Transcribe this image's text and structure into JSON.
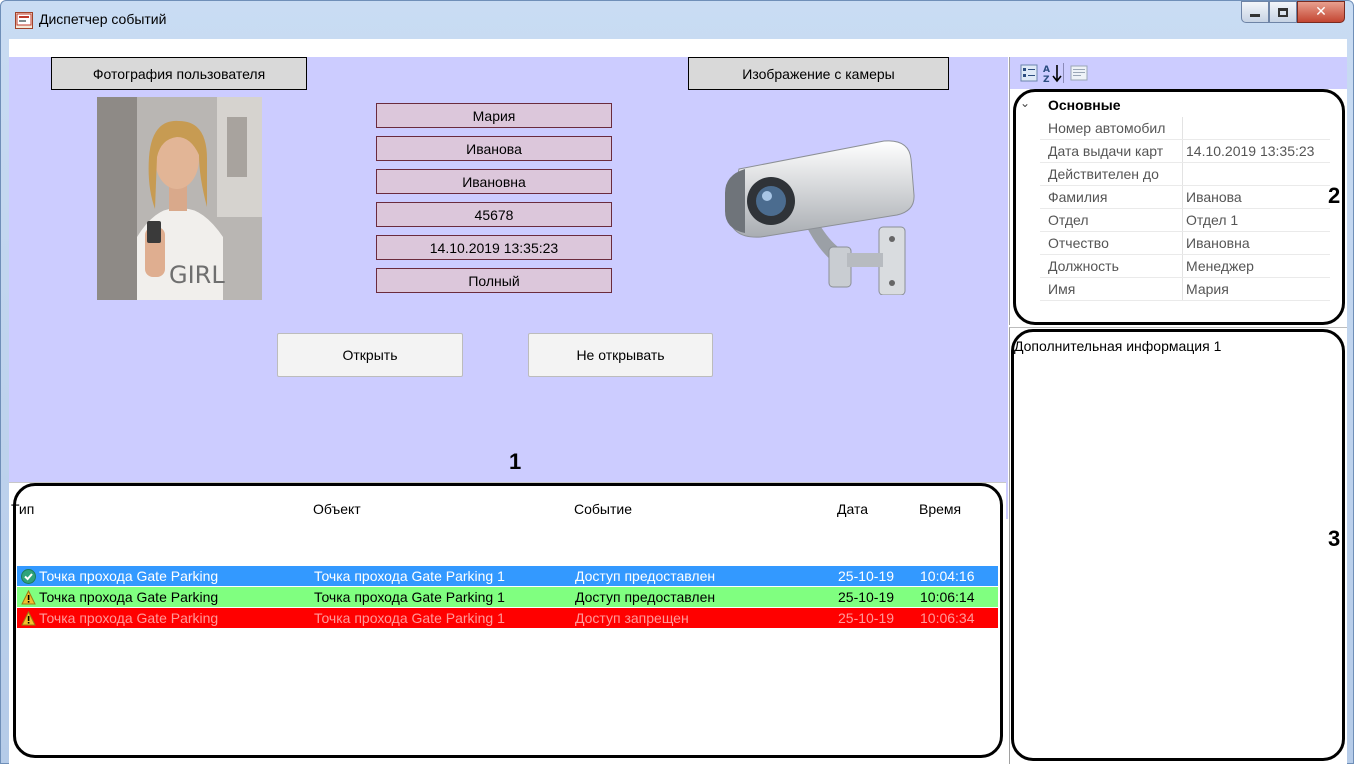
{
  "window": {
    "title": "Диспетчер событий"
  },
  "card": {
    "photo_header": "Фотография пользователя",
    "camera_header": "Изображение с камеры",
    "first_name": "Мария",
    "last_name": "Иванова",
    "patronymic": "Ивановна",
    "number": "45678",
    "datetime": "14.10.2019 13:35:23",
    "access_level": "Полный",
    "open_button": "Открыть",
    "dont_open_button": "Не открывать",
    "photo_shirt_text": "GIRL"
  },
  "labels": {
    "area1": "1",
    "area2": "2",
    "area3": "3"
  },
  "events": {
    "columns": [
      "Тип",
      "Объект",
      "Событие",
      "Дата",
      "Время"
    ],
    "rows": [
      {
        "type": "Точка прохода Gate Parking",
        "object": "Точка прохода Gate Parking 1",
        "event": "Доступ предоставлен",
        "date": "25-10-19",
        "time": "10:04:16",
        "color": "#3399ff",
        "text_color": "#ffffff",
        "icon": "check-icon"
      },
      {
        "type": "Точка прохода Gate Parking",
        "object": "Точка прохода Gate Parking 1",
        "event": "Доступ предоставлен",
        "date": "25-10-19",
        "time": "10:06:14",
        "color": "#80ff80",
        "text_color": "#000000",
        "icon": "warning-icon"
      },
      {
        "type": "Точка прохода Gate Parking",
        "object": "Точка прохода Gate Parking 1",
        "event": "Доступ запрещен",
        "date": "25-10-19",
        "time": "10:06:34",
        "color": "#ff0000",
        "text_color": "#ff9a9a",
        "icon": "warning-icon"
      }
    ]
  },
  "properties": {
    "category": "Основные",
    "rows": [
      {
        "key": "Номер автомобил",
        "value": ""
      },
      {
        "key": "Дата выдачи карт",
        "value": "14.10.2019 13:35:23"
      },
      {
        "key": "Действителен до",
        "value": ""
      },
      {
        "key": "Фамилия",
        "value": "Иванова"
      },
      {
        "key": "Отдел",
        "value": "Отдел 1"
      },
      {
        "key": "Отчество",
        "value": "Ивановна"
      },
      {
        "key": "Должность",
        "value": "Менеджер"
      },
      {
        "key": "Имя",
        "value": "Мария"
      }
    ]
  },
  "extra": {
    "text": "Дополнительная информация 1"
  }
}
